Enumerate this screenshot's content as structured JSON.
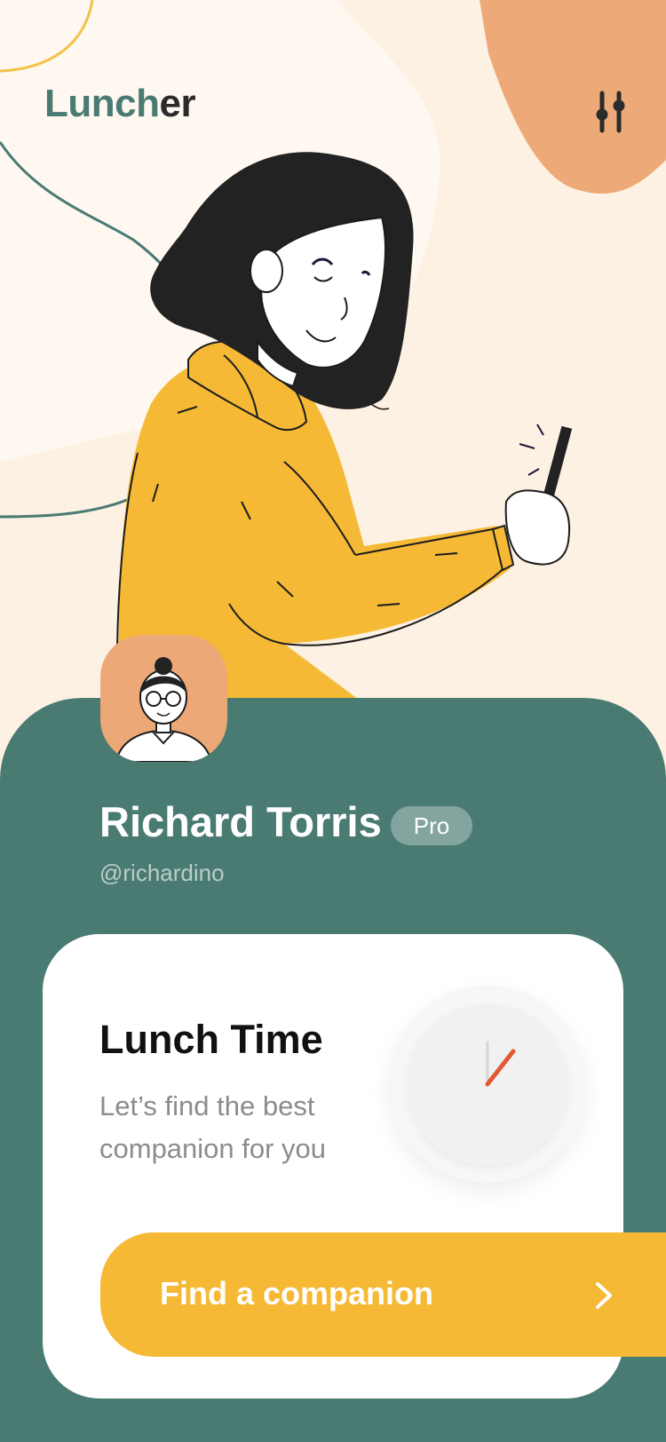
{
  "app": {
    "logo_part1": "Lunch",
    "logo_part2": "er",
    "filter_icon": "sliders-icon"
  },
  "profile": {
    "name": "Richard Torris",
    "badge": "Pro",
    "handle": "@richardino",
    "avatar_icon": "man-with-glasses-avatar"
  },
  "lunch_card": {
    "title": "Lunch Time",
    "subtitle": "Let’s find the best companion for you",
    "clock_icon": "clock-icon"
  },
  "cta": {
    "label": "Find a companion",
    "arrow_icon": "chevron-right-icon"
  },
  "colors": {
    "background": "#fdf1e3",
    "teal": "#4a7b72",
    "peach": "#eca977",
    "yellow": "#f5b935",
    "dark": "#2b2b2b",
    "clock_hand": "#e05a34"
  }
}
